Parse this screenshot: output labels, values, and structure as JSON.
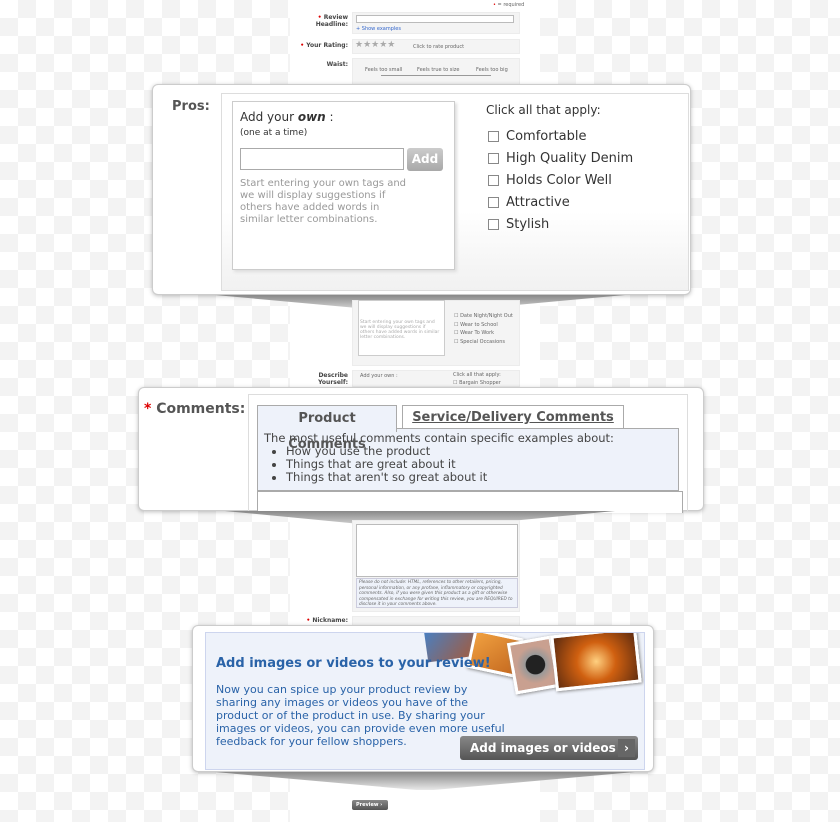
{
  "background_form": {
    "required_note": "= required",
    "review_headline_label": "Review Headline:",
    "show_examples": "+ Show examples",
    "rating_label": "Your Rating:",
    "rating_hint": "Click to rate product",
    "rating_value": 0,
    "waist_label": "Waist:",
    "waist_options": [
      "Feels too small",
      "Feels true to size",
      "Feels too big"
    ],
    "small_tags": [
      "Date Night/Night Out",
      "Wear to School",
      "Wear To Work",
      "Special Occasions"
    ],
    "small_hint": "Start entering your own tags and we will display suggestions if others have added words in similar letter combinations.",
    "describe_label": "Describe Yourself:",
    "describe_add": "Add your own :",
    "describe_sub": "(one at a time)",
    "describe_click": "Click all that apply:",
    "describe_first": "Bargain Shopper",
    "notice": "Please do not include: HTML, references to other retailers, pricing, personal information, or any profane, inflammatory or copyrighted comments. Also, if you were given this product as a gift or otherwise compensated in exchange for writing this review, you are REQUIRED to disclose it in your comments above.",
    "nickname_label": "Nickname:",
    "preview_button": "Preview"
  },
  "pros": {
    "label": "Pros:",
    "add_title_pre": "Add your ",
    "add_title_em": "own",
    "add_title_post": " :",
    "sub": "(one at a time)",
    "input_value": "",
    "add_button": "Add",
    "hint": "Start entering your own tags and we will display suggestions if others have added words in similar letter combinations.",
    "click_all": "Click all that apply:",
    "options": [
      "Comfortable",
      "High Quality Denim",
      "Holds Color Well",
      "Attractive",
      "Stylish"
    ]
  },
  "comments": {
    "label": "Comments:",
    "tabs": [
      "Product Comments",
      "Service/Delivery Comments"
    ],
    "intro": "The most useful comments contain specific examples about:",
    "bullets": [
      "How you use the product",
      "Things that are great about it",
      "Things that aren't so great about it"
    ]
  },
  "media": {
    "title": "Add images or videos to your review!",
    "body": "Now you can spice up your product review by sharing any images or videos you have of the product or of the product in use. By sharing your images or videos, you can provide even more useful feedback for your fellow shoppers.",
    "button": "Add images or videos",
    "accent": "#2a63a8"
  }
}
